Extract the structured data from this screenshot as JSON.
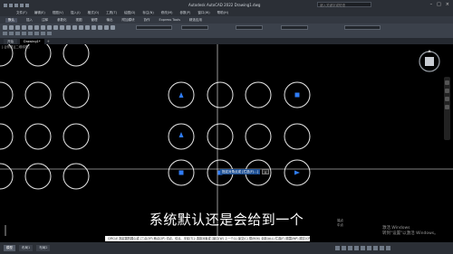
{
  "window": {
    "title": "Autodesk AutoCAD 2022  Drawing1.dwg",
    "search_placeholder": "键入关键字或短语"
  },
  "menu": [
    "文件(F)",
    "编辑(E)",
    "视图(V)",
    "插入(I)",
    "格式(O)",
    "工具(T)",
    "绘图(D)",
    "标注(N)",
    "修改(M)",
    "参数(P)",
    "窗口(W)",
    "帮助(H)"
  ],
  "ribbon_tabs": [
    "默认",
    "插入",
    "注释",
    "参数化",
    "视图",
    "管理",
    "输出",
    "附加模块",
    "协作",
    "Express Tools",
    "精选应用"
  ],
  "ribbon_active_tab": "默认",
  "document_tabs": [
    {
      "label": "开始",
      "active": false
    },
    {
      "label": "Drawing1*",
      "active": true
    }
  ],
  "viewport_label": "[-][俯视][二维线框]",
  "dynamic_input": {
    "prompt": "指定对角点或 [栏选(F)...]",
    "value": "0"
  },
  "subtitle": "系统默认还是会给到一个",
  "snap_tooltip": [
    "端点",
    "中点"
  ],
  "activate_windows": {
    "line1": "激活 Windows",
    "line2": "转到\"设置\"以激活 Windows。"
  },
  "command_line": "CIRCLE 指定圆的圆心或 [三点(3P) 两点(2P) 切点、切点、半径(T)]: 选择对象或 [窗口(W) 上一个(L) 窗交(C) 框(BOX) 全部(ALL) 栏选(F) 圈围(WP) 圈交(CP)]:",
  "layout_tabs": [
    {
      "label": "模型",
      "active": true
    },
    {
      "label": "布局1",
      "active": false
    },
    {
      "label": "布局2",
      "active": false
    }
  ],
  "colors": {
    "canvas": "#000000",
    "circle": "#e6e6e6",
    "grip": "#2f7cf6",
    "crosshair": "#ffffff"
  }
}
